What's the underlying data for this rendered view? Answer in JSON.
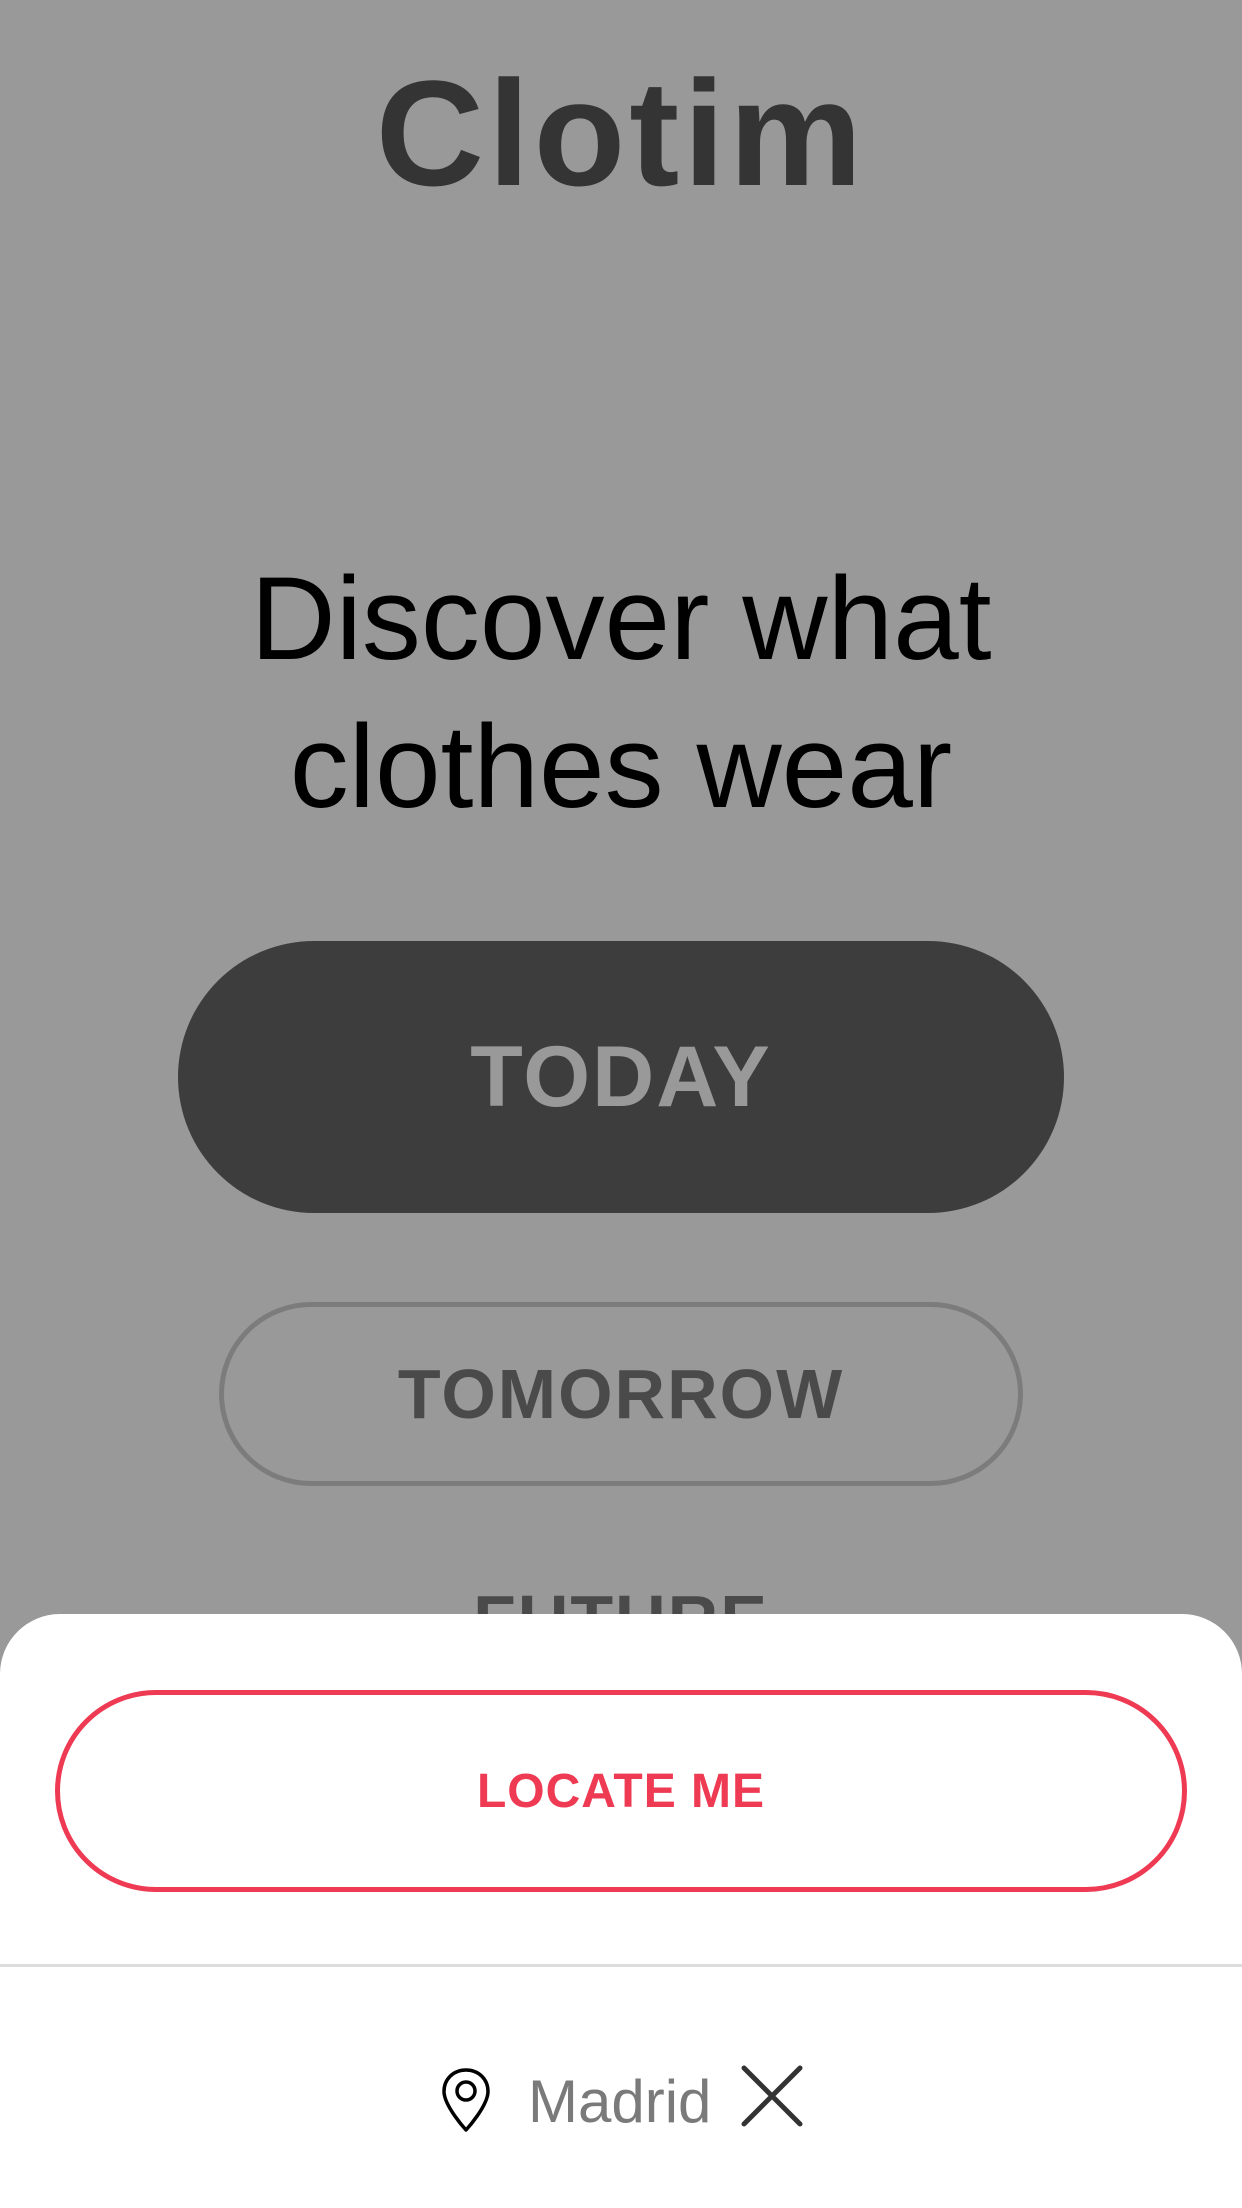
{
  "app": {
    "logo": "Clotim"
  },
  "hero": {
    "tagline_line1": "Discover what",
    "tagline_line2": "clothes wear"
  },
  "options": {
    "today_label": "TODAY",
    "tomorrow_label": "TOMORROW",
    "future_label": "FUTURE"
  },
  "sheet": {
    "locate_label": "LOCATE ME",
    "city": "Madrid",
    "location_icon": "map-pin-icon",
    "clear_icon": "close-icon"
  },
  "colors": {
    "accent": "#ee3a52",
    "overlay": "#999999",
    "dark_button": "#3d3d3d"
  }
}
